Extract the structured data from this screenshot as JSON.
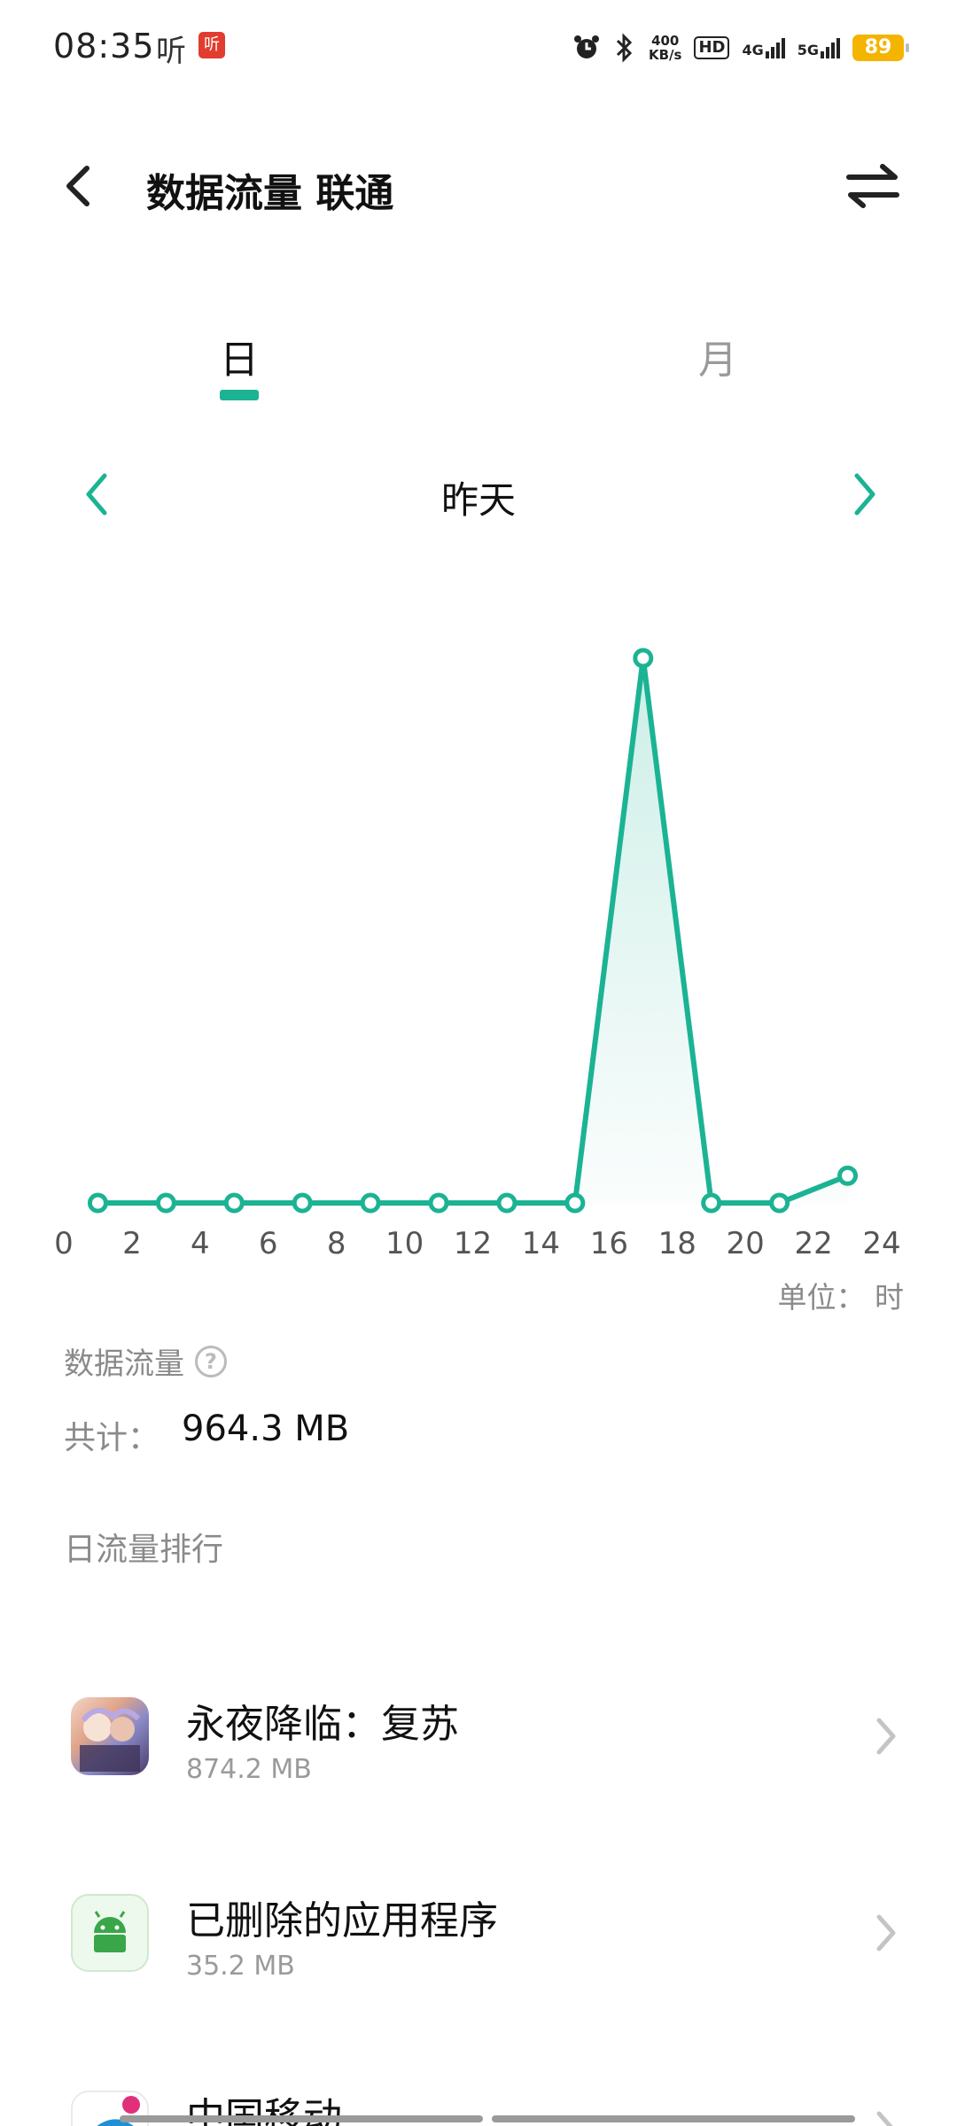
{
  "status": {
    "time": "08:35",
    "ting": "听",
    "ting_badge": "听",
    "speed_value": "400",
    "speed_unit": "KB/s",
    "hd": "HD",
    "net1": "4G",
    "net2": "5G",
    "battery": "89"
  },
  "header": {
    "title": "数据流量 联通"
  },
  "tabs": {
    "day": "日",
    "month": "月"
  },
  "datenav": {
    "label": "昨天"
  },
  "chart_data": {
    "type": "line",
    "x": [
      1,
      3,
      5,
      7,
      9,
      11,
      13,
      15,
      17,
      19,
      21,
      23
    ],
    "values": [
      0,
      0,
      0,
      0,
      0,
      0,
      0,
      0,
      100,
      0,
      0,
      5
    ],
    "xticks": [
      "0",
      "2",
      "4",
      "6",
      "8",
      "10",
      "12",
      "14",
      "16",
      "18",
      "20",
      "22",
      "24"
    ],
    "xlim": [
      0,
      24
    ],
    "ylim": [
      0,
      100
    ],
    "unit_label": "单位： 时",
    "line_color": "#1bb394",
    "grid": false
  },
  "summary": {
    "title": "数据流量",
    "help_icon": "question-icon",
    "total_label": "共计：",
    "total_value": "964.3 MB",
    "rank_title": "日流量排行"
  },
  "apps": [
    {
      "name": "永夜降临：复苏",
      "size": "874.2 MB",
      "icon": "game-icon"
    },
    {
      "name": "已删除的应用程序",
      "size": "35.2 MB",
      "icon": "android-icon"
    },
    {
      "name": "中国移动",
      "size": "",
      "icon": "china-mobile-icon"
    }
  ],
  "colors": {
    "accent": "#1bb394",
    "muted": "#8a8a8a"
  }
}
